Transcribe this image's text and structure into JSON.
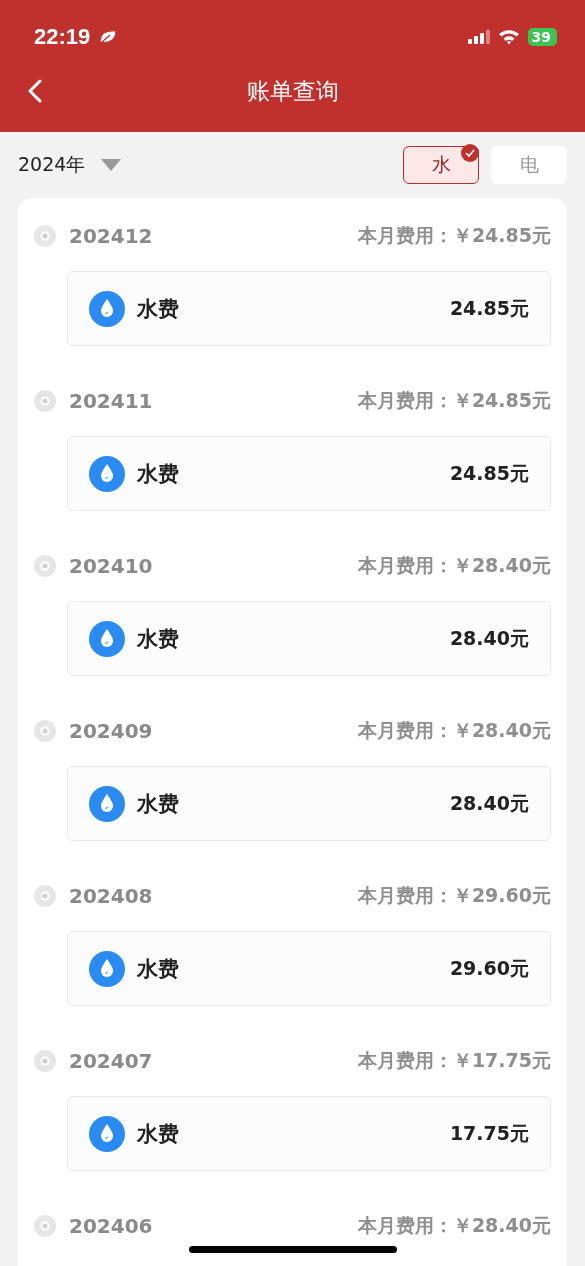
{
  "status_bar": {
    "time": "22:19",
    "battery": "39"
  },
  "nav": {
    "title": "账单查询"
  },
  "filter": {
    "year": "2024年",
    "tabs": [
      {
        "label": "水",
        "selected": true
      },
      {
        "label": "电",
        "selected": false
      }
    ]
  },
  "months": [
    {
      "month": "202412",
      "total_label": "本月费用：",
      "total": "￥24.85元",
      "items": [
        {
          "name": "水费",
          "amount": "24.85元"
        }
      ]
    },
    {
      "month": "202411",
      "total_label": "本月费用：",
      "total": "￥24.85元",
      "items": [
        {
          "name": "水费",
          "amount": "24.85元"
        }
      ]
    },
    {
      "month": "202410",
      "total_label": "本月费用：",
      "total": "￥28.40元",
      "items": [
        {
          "name": "水费",
          "amount": "28.40元"
        }
      ]
    },
    {
      "month": "202409",
      "total_label": "本月费用：",
      "total": "￥28.40元",
      "items": [
        {
          "name": "水费",
          "amount": "28.40元"
        }
      ]
    },
    {
      "month": "202408",
      "total_label": "本月费用：",
      "total": "￥29.60元",
      "items": [
        {
          "name": "水费",
          "amount": "29.60元"
        }
      ]
    },
    {
      "month": "202407",
      "total_label": "本月费用：",
      "total": "￥17.75元",
      "items": [
        {
          "name": "水费",
          "amount": "17.75元"
        }
      ]
    },
    {
      "month": "202406",
      "total_label": "本月费用：",
      "total": "￥28.40元"
    }
  ]
}
